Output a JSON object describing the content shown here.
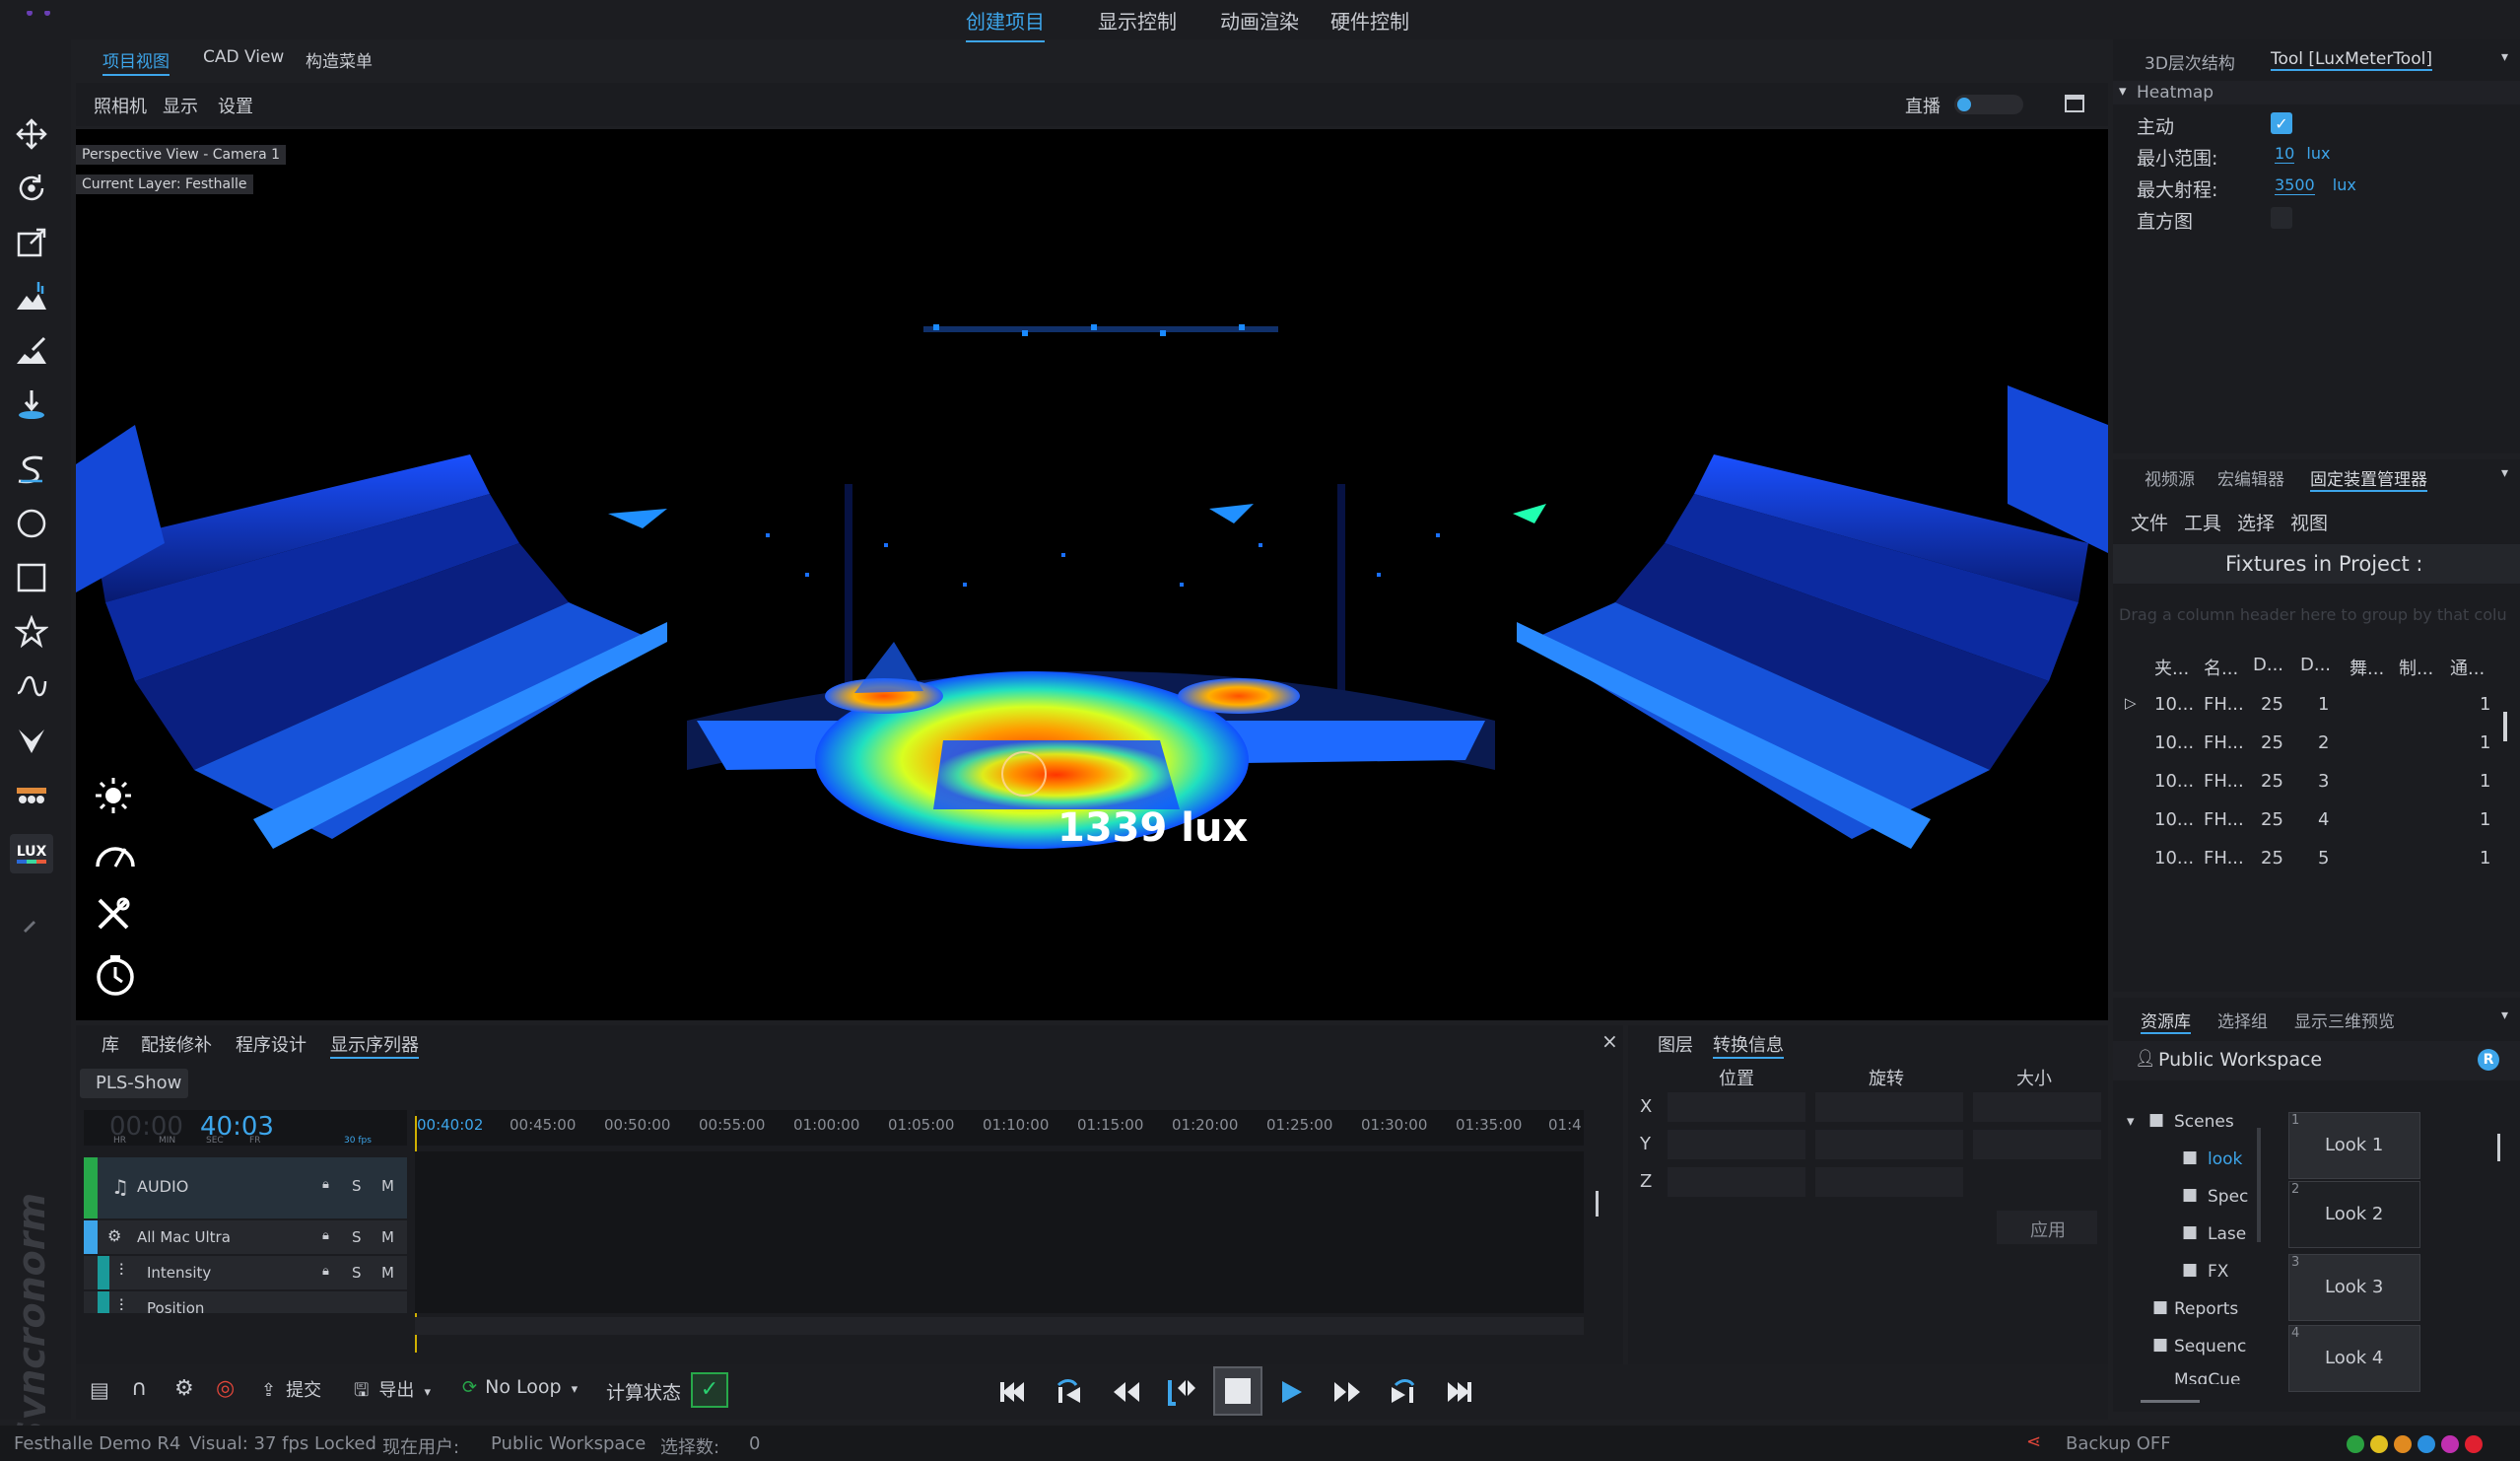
{
  "top_menu": {
    "items": [
      "创建项目",
      "显示控制",
      "动画渲染",
      "硬件控制"
    ]
  },
  "view_tabs": [
    "项目视图",
    "CAD View",
    "构造菜单"
  ],
  "view_toolbar": {
    "items": [
      "照相机",
      "显示",
      "设置"
    ],
    "live_label": "直播"
  },
  "viewport": {
    "label_view": "Perspective View - Camera 1",
    "label_layer": "Current Layer: Festhalle",
    "lux_readout": "1339 lux"
  },
  "lux_tool_label": "LUX",
  "right_top": {
    "tabs": [
      "3D层次结构",
      "Tool [LuxMeterTool]"
    ],
    "section": "Heatmap",
    "rows": [
      {
        "label": "主动"
      },
      {
        "label": "最小范围:",
        "value": "10",
        "unit": "lux"
      },
      {
        "label": "最大射程:",
        "value": "3500",
        "unit": "lux"
      },
      {
        "label": "直方图"
      }
    ]
  },
  "fixtures_panel": {
    "tabs": [
      "视频源",
      "宏编辑器",
      "固定装置管理器"
    ],
    "menu": [
      "文件",
      "工具",
      "选择",
      "视图"
    ],
    "title": "Fixtures in Project :",
    "group_hint": "Drag a column header here to group by that colu",
    "columns": [
      "夹...",
      "名...",
      "D...",
      "D...",
      "舞...",
      "制...",
      "通..."
    ],
    "rows": [
      [
        "10...",
        "FH...",
        "25",
        "1",
        "1"
      ],
      [
        "10...",
        "FH...",
        "25",
        "2",
        "1"
      ],
      [
        "10...",
        "FH...",
        "25",
        "3",
        "1"
      ],
      [
        "10...",
        "FH...",
        "25",
        "4",
        "1"
      ],
      [
        "10...",
        "FH...",
        "25",
        "5",
        "1"
      ]
    ]
  },
  "bottom_tabs": [
    "库",
    "配接修补",
    "程序设计",
    "显示序列器"
  ],
  "timeline": {
    "show_name": "PLS-Show",
    "timecode_dim": "00:00",
    "timecode": "40:03",
    "units": [
      "HR",
      "MIN",
      "SEC",
      "FR"
    ],
    "fps": "30 fps",
    "playhead": "00:40:02",
    "ticks": [
      "00:45:00",
      "00:50:00",
      "00:55:00",
      "01:00:00",
      "01:05:00",
      "01:10:00",
      "01:15:00",
      "01:20:00",
      "01:25:00",
      "01:30:00",
      "01:35:00",
      "01:4"
    ],
    "tracks": [
      {
        "name": "AUDIO",
        "icon": "music-icon"
      },
      {
        "name": "All Mac Ultra",
        "icon": "fixture-icon"
      },
      {
        "name": "Intensity",
        "icon": "sliders-icon"
      },
      {
        "name": "Position",
        "icon": "sliders-icon"
      }
    ],
    "track_buttons": [
      "S",
      "M"
    ]
  },
  "transform_panel": {
    "tabs": [
      "图层",
      "转换信息"
    ],
    "headers": [
      "位置",
      "旋转",
      "大小"
    ],
    "axes": [
      "X",
      "Y",
      "Z"
    ],
    "apply": "应用"
  },
  "assets_panel": {
    "tabs": [
      "资源库",
      "选择组",
      "显示三维预览"
    ],
    "workspace": "Public Workspace",
    "badge": "R",
    "tree": [
      "Scenes",
      "look",
      "Spec",
      "Lase",
      "FX",
      "Reports",
      "Sequenc",
      "MsqCue"
    ],
    "looks": [
      {
        "num": "1",
        "label": "Look 1"
      },
      {
        "num": "2",
        "label": "Look 2"
      },
      {
        "num": "3",
        "label": "Look 3"
      },
      {
        "num": "4",
        "label": "Look 4"
      }
    ]
  },
  "bottom_toolbar": {
    "submit": "提交",
    "export": "导出",
    "loop": "No Loop",
    "calc": "计算状态"
  },
  "status_bar": {
    "project": "Festhalle Demo R4",
    "visual": "Visual: 37 fps Locked",
    "user_label": "现在用户:",
    "user": "Public Workspace",
    "sel_label": "选择数:",
    "sel_count": "0",
    "backup": "Backup OFF"
  },
  "brand_watermark": "Syncronorm",
  "colors": {
    "accent": "#3da5ea",
    "bg": "#1e1f23",
    "panel": "#1b1c20"
  }
}
